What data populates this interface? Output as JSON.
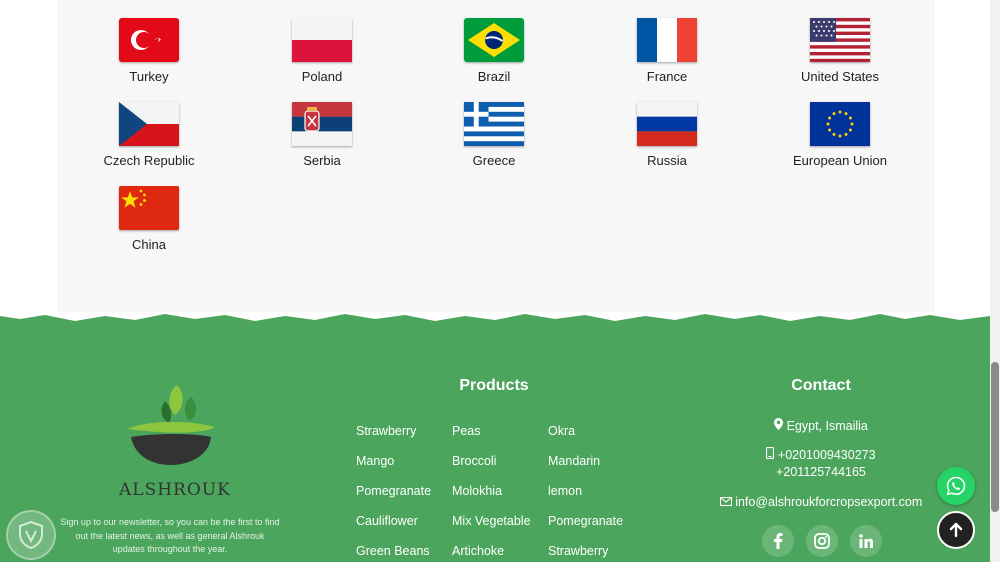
{
  "flags": [
    {
      "name": "Turkey"
    },
    {
      "name": "Poland"
    },
    {
      "name": "Brazil"
    },
    {
      "name": "France"
    },
    {
      "name": "United States"
    },
    {
      "name": "Czech Republic"
    },
    {
      "name": "Serbia"
    },
    {
      "name": "Greece"
    },
    {
      "name": "Russia"
    },
    {
      "name": "European Union"
    },
    {
      "name": "China"
    }
  ],
  "footer": {
    "logo_text": "ALSHROUK",
    "newsletter_text": "Sign up to our newsletter, so you can be the first to find out the latest news, as well as general Alshrouk updates throughout the year.",
    "products_title": "Products",
    "products": [
      [
        "Strawberry",
        "Peas",
        "Okra"
      ],
      [
        "Mango",
        "Broccoli",
        "Mandarin"
      ],
      [
        "Pomegranate",
        "Molokhia",
        "lemon"
      ],
      [
        "Cauliflower",
        "Mix Vegetable",
        "Pomegranate"
      ],
      [
        "Green Beans",
        "Artichoke",
        "Strawberry"
      ]
    ],
    "contact_title": "Contact",
    "address": "Egypt, Ismailia",
    "phone_1": "+0201009430273",
    "phone_2": "+201125744165",
    "email": "info@alshroukforcropsexport.com",
    "social": [
      "facebook-icon",
      "instagram-icon",
      "linkedin-icon"
    ],
    "colors": {
      "footer_bg": "#4ba55c",
      "whatsapp": "#25d366"
    }
  }
}
